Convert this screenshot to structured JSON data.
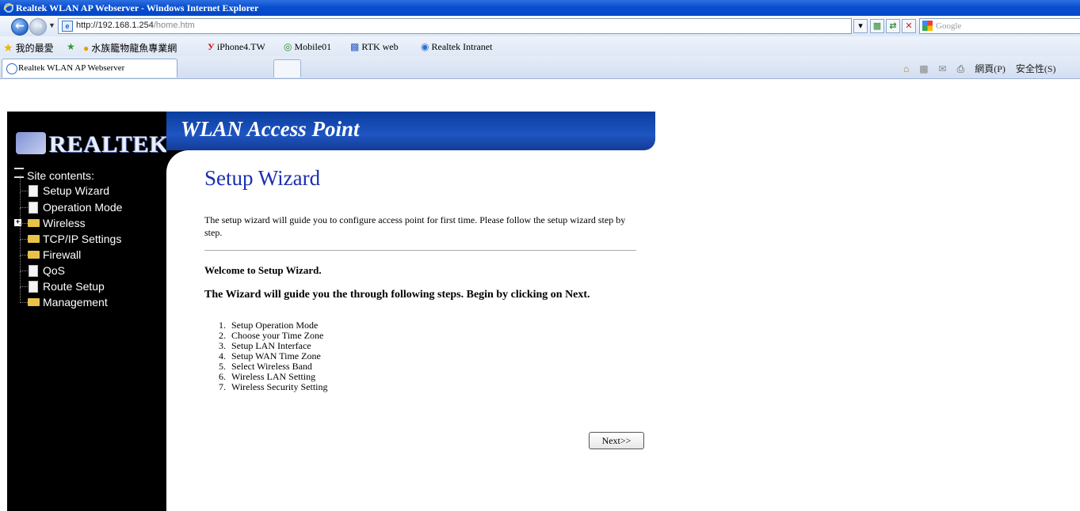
{
  "window": {
    "title": "Realtek WLAN AP Webserver - Windows Internet Explorer"
  },
  "address_bar": {
    "url_host": "http://192.168.1.254",
    "url_path": "/home.htm",
    "search_placeholder": "Google"
  },
  "favorites": {
    "label": "我的最愛",
    "items": [
      "水族籠物龍魚專業網",
      "iPhone4.TW",
      "Mobile01",
      "RTK web",
      "Realtek Intranet"
    ]
  },
  "tab": {
    "label": "Realtek WLAN AP Webserver"
  },
  "command_bar": {
    "page_label": "網頁(P)",
    "safety_label": "安全性(S)"
  },
  "sidebar": {
    "logo_text": "REALTEK",
    "tree_root": "Site contents:",
    "items": [
      {
        "label": "Setup Wizard",
        "type": "page"
      },
      {
        "label": "Operation Mode",
        "type": "page"
      },
      {
        "label": "Wireless",
        "type": "folder-expandable"
      },
      {
        "label": "TCP/IP Settings",
        "type": "folder"
      },
      {
        "label": "Firewall",
        "type": "folder"
      },
      {
        "label": "QoS",
        "type": "page"
      },
      {
        "label": "Route Setup",
        "type": "page"
      },
      {
        "label": "Management",
        "type": "folder"
      }
    ]
  },
  "header": {
    "title": "WLAN Access Point"
  },
  "main": {
    "title": "Setup Wizard",
    "intro": "The setup wizard will guide you to configure access point for first time. Please follow the setup wizard step by step.",
    "welcome": "Welcome to Setup Wizard.",
    "guide": "The Wizard will guide you the through following steps. Begin by clicking on Next.",
    "steps": [
      "Setup Operation Mode",
      "Choose your Time Zone",
      "Setup LAN Interface",
      "Setup WAN Time Zone",
      "Select Wireless Band",
      "Wireless LAN Setting",
      "Wireless Security Setting"
    ],
    "next_label": "Next>>"
  },
  "colors": {
    "title_bar": "#0047c8",
    "header": "#1e55c2",
    "title_text": "#1b2fb0",
    "sidebar": "#000000"
  }
}
